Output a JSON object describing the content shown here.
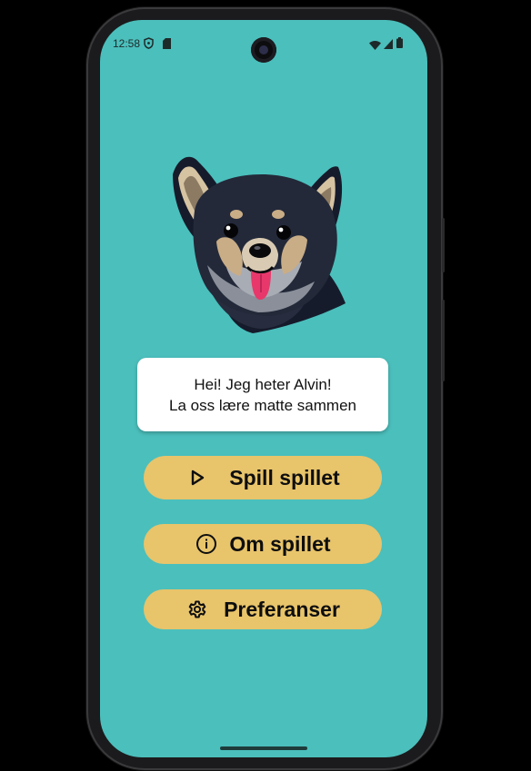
{
  "status_bar": {
    "time": "12:58",
    "icons": [
      "shield-icon",
      "sd-card-icon",
      "wifi-icon",
      "signal-icon",
      "battery-icon"
    ]
  },
  "mascot": {
    "icon": "dog-mascot-icon"
  },
  "speech_bubble": {
    "line1": "Hei! Jeg heter Alvin!",
    "line2": "La oss lære matte sammen"
  },
  "menu": {
    "play_label": "Spill spillet",
    "play_icon": "play-icon",
    "about_label": "Om spillet",
    "about_icon": "info-icon",
    "prefs_label": "Preferanser",
    "prefs_icon": "gear-icon"
  },
  "colors": {
    "background": "#4bbfbc",
    "button": "#e8c46b",
    "bubble": "#ffffff"
  }
}
